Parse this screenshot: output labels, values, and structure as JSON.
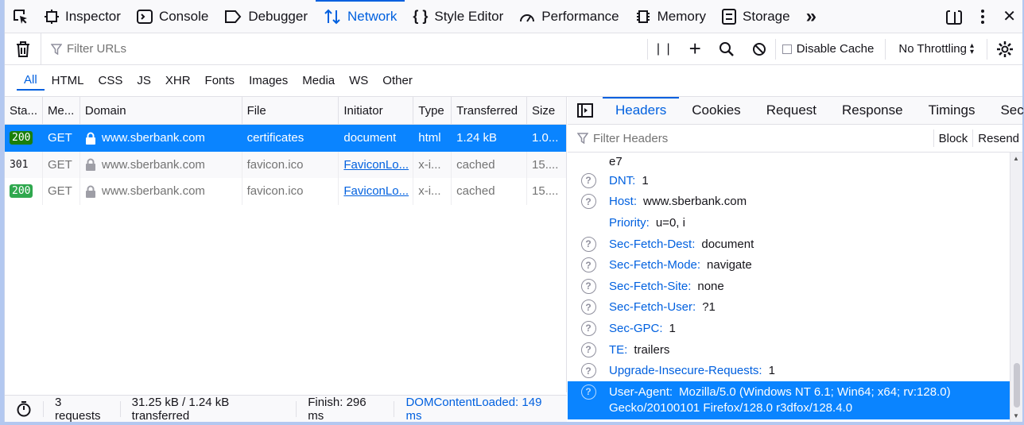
{
  "toolbox": {
    "tabs": [
      {
        "label": "Inspector",
        "icon": "inspector-icon"
      },
      {
        "label": "Console",
        "icon": "console-icon"
      },
      {
        "label": "Debugger",
        "icon": "debugger-icon"
      },
      {
        "label": "Network",
        "icon": "network-icon",
        "active": true
      },
      {
        "label": "Style Editor",
        "icon": "style-editor-icon"
      },
      {
        "label": "Performance",
        "icon": "performance-icon"
      },
      {
        "label": "Memory",
        "icon": "memory-icon"
      },
      {
        "label": "Storage",
        "icon": "storage-icon"
      }
    ],
    "overflow_glyph": "»",
    "close_glyph": "✕"
  },
  "toolbar": {
    "filter_placeholder": "Filter URLs",
    "pause_glyph": "| |",
    "add_glyph": "+",
    "disable_cache_label": "Disable Cache",
    "throttling_label": "No Throttling"
  },
  "type_filters": [
    "All",
    "HTML",
    "CSS",
    "JS",
    "XHR",
    "Fonts",
    "Images",
    "Media",
    "WS",
    "Other"
  ],
  "requests": {
    "columns": [
      "Sta...",
      "Me...",
      "Domain",
      "File",
      "Initiator",
      "Type",
      "Transferred",
      "Size"
    ],
    "rows": [
      {
        "status": "200",
        "method": "GET",
        "domain": "www.sberbank.com",
        "file": "certificates",
        "initiator": "document",
        "type": "html",
        "transferred": "1.24 kB",
        "size": "1.0..."
      },
      {
        "status": "301",
        "method": "GET",
        "domain": "www.sberbank.com",
        "file": "favicon.ico",
        "initiator": "FaviconLo...",
        "type": "x-i...",
        "transferred": "cached",
        "size": "15...."
      },
      {
        "status": "200",
        "method": "GET",
        "domain": "www.sberbank.com",
        "file": "favicon.ico",
        "initiator": "FaviconLo...",
        "type": "x-i...",
        "transferred": "cached",
        "size": "15...."
      }
    ]
  },
  "footer": {
    "requests": "3 requests",
    "transferred": "31.25 kB / 1.24 kB transferred",
    "finish": "Finish: 296 ms",
    "dcl": "DOMContentLoaded: 149 ms"
  },
  "details": {
    "tabs": [
      "Headers",
      "Cookies",
      "Request",
      "Response",
      "Timings",
      "Secur"
    ],
    "filter_placeholder": "Filter Headers",
    "block_label": "Block",
    "resend_label": "Resend",
    "partial_value": "e7",
    "headers": [
      {
        "name": "DNT:",
        "value": "1",
        "help": true
      },
      {
        "name": "Host:",
        "value": "www.sberbank.com",
        "help": true
      },
      {
        "name": "Priority:",
        "value": "u=0, i",
        "help": false
      },
      {
        "name": "Sec-Fetch-Dest:",
        "value": "document",
        "help": true
      },
      {
        "name": "Sec-Fetch-Mode:",
        "value": "navigate",
        "help": true
      },
      {
        "name": "Sec-Fetch-Site:",
        "value": "none",
        "help": true
      },
      {
        "name": "Sec-Fetch-User:",
        "value": "?1",
        "help": true
      },
      {
        "name": "Sec-GPC:",
        "value": "1",
        "help": true
      },
      {
        "name": "TE:",
        "value": "trailers",
        "help": true
      },
      {
        "name": "Upgrade-Insecure-Requests:",
        "value": "1",
        "help": true
      },
      {
        "name": "User-Agent:",
        "value": "Mozilla/5.0 (Windows NT 6.1; Win64; x64; rv:128.0) Gecko/20100101 Firefox/128.0 r3dfox/128.4.0",
        "help": true,
        "selected": true
      }
    ]
  },
  "colors": {
    "accent": "#0060df",
    "selection": "#0a84ff",
    "status_ok": "#2fa84e"
  }
}
